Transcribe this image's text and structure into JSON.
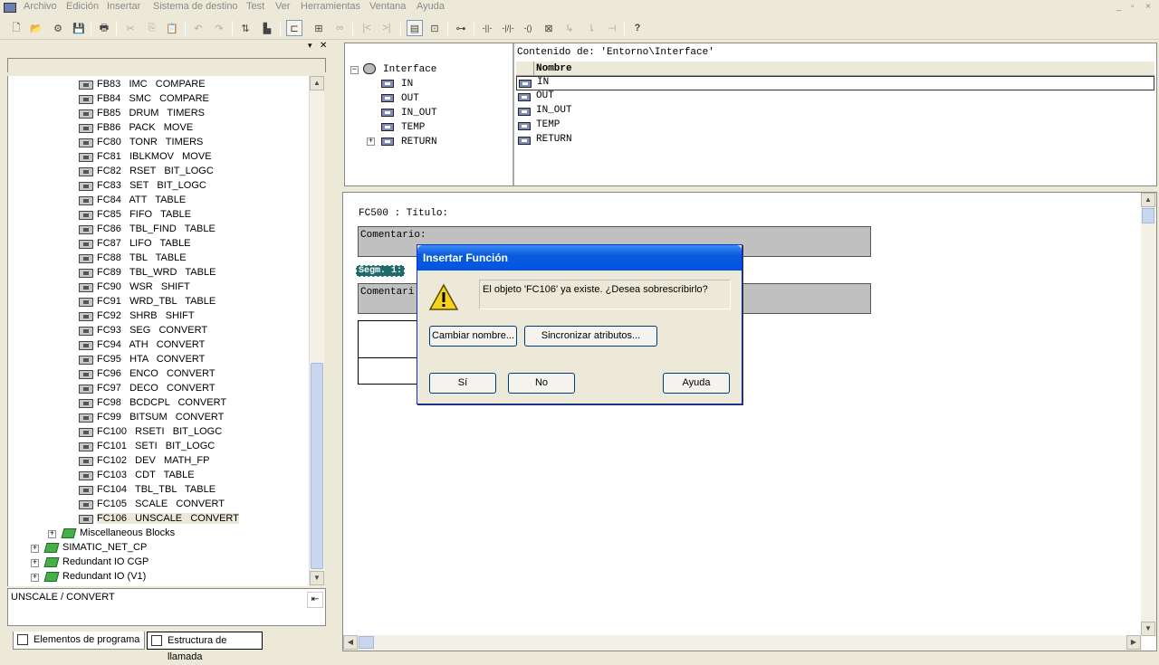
{
  "menu": {
    "items": [
      "Archivo",
      "Edición",
      "Insertar",
      "Sistema de destino",
      "Test",
      "Ver",
      "Herramientas",
      "Ventana",
      "Ayuda"
    ],
    "window_controls": [
      "_",
      "▫",
      "×"
    ]
  },
  "toolbar": {
    "buttons": [
      {
        "name": "new-icon",
        "glyph": "🗋"
      },
      {
        "name": "open-icon",
        "glyph": "📂"
      },
      {
        "name": "accessible-nodes-icon",
        "glyph": "⚙"
      },
      {
        "name": "save-icon",
        "glyph": "💾"
      },
      {
        "name": "print-icon",
        "glyph": "🖶"
      },
      {
        "name": "cut-icon",
        "glyph": "✂"
      },
      {
        "name": "copy-icon",
        "glyph": "⎘"
      },
      {
        "name": "paste-icon",
        "glyph": "📋"
      },
      {
        "name": "undo-icon",
        "glyph": "↶"
      },
      {
        "name": "redo-icon",
        "glyph": "↷"
      },
      {
        "name": "load-icon",
        "glyph": "⇅"
      },
      {
        "name": "download-icon",
        "glyph": "▙"
      },
      {
        "name": "monitor-icon",
        "glyph": "⊏"
      },
      {
        "name": "module-icon",
        "glyph": "⊞"
      },
      {
        "name": "glasses-icon",
        "glyph": "∞"
      },
      {
        "name": "prev-icon",
        "glyph": "|<"
      },
      {
        "name": "next-icon",
        "glyph": ">|"
      },
      {
        "name": "overview-icon",
        "glyph": "▤"
      },
      {
        "name": "zoom-icon",
        "glyph": "⊡"
      },
      {
        "name": "network-icon",
        "glyph": "⊶"
      },
      {
        "name": "contact-no-icon",
        "glyph": "-||-"
      },
      {
        "name": "contact-nc-icon",
        "glyph": "-|/|-"
      },
      {
        "name": "coil-icon",
        "glyph": "-()"
      },
      {
        "name": "box-icon",
        "glyph": "⊠"
      },
      {
        "name": "branch-open-icon",
        "glyph": "↳"
      },
      {
        "name": "branch-close-icon",
        "glyph": "⇂"
      },
      {
        "name": "connection-icon",
        "glyph": "⊣"
      },
      {
        "name": "help-icon",
        "glyph": "?"
      }
    ]
  },
  "left_pane": {
    "tree": [
      {
        "label": "FB83   IMC   COMPARE"
      },
      {
        "label": "FB84   SMC   COMPARE"
      },
      {
        "label": "FB85   DRUM   TIMERS"
      },
      {
        "label": "FB86   PACK   MOVE"
      },
      {
        "label": "FC80   TONR   TIMERS"
      },
      {
        "label": "FC81   IBLKMOV   MOVE"
      },
      {
        "label": "FC82   RSET   BIT_LOGC"
      },
      {
        "label": "FC83   SET   BIT_LOGC"
      },
      {
        "label": "FC84   ATT   TABLE"
      },
      {
        "label": "FC85   FIFO   TABLE"
      },
      {
        "label": "FC86   TBL_FIND   TABLE"
      },
      {
        "label": "FC87   LIFO   TABLE"
      },
      {
        "label": "FC88   TBL   TABLE"
      },
      {
        "label": "FC89   TBL_WRD   TABLE"
      },
      {
        "label": "FC90   WSR   SHIFT"
      },
      {
        "label": "FC91   WRD_TBL   TABLE"
      },
      {
        "label": "FC92   SHRB   SHIFT"
      },
      {
        "label": "FC93   SEG   CONVERT"
      },
      {
        "label": "FC94   ATH   CONVERT"
      },
      {
        "label": "FC95   HTA   CONVERT"
      },
      {
        "label": "FC96   ENCO   CONVERT"
      },
      {
        "label": "FC97   DECO   CONVERT"
      },
      {
        "label": "FC98   BCDCPL   CONVERT"
      },
      {
        "label": "FC99   BITSUM   CONVERT"
      },
      {
        "label": "FC100   RSETI   BIT_LOGC"
      },
      {
        "label": "FC101   SETI   BIT_LOGC"
      },
      {
        "label": "FC102   DEV   MATH_FP"
      },
      {
        "label": "FC103   CDT   TABLE"
      },
      {
        "label": "FC104   TBL_TBL   TABLE"
      },
      {
        "label": "FC105   SCALE   CONVERT"
      },
      {
        "label": "FC106   UNSCALE   CONVERT"
      }
    ],
    "folders": [
      {
        "label": "Miscellaneous Blocks"
      },
      {
        "label": "SIMATIC_NET_CP"
      },
      {
        "label": "Redundant IO CGP"
      },
      {
        "label": "Redundant IO (V1)"
      }
    ],
    "status_text": "UNSCALE / CONVERT",
    "tabs": [
      "Elementos de programa",
      "Estructura de llamada"
    ]
  },
  "interface": {
    "root": "Interface",
    "tree_items": [
      "IN",
      "OUT",
      "IN_OUT",
      "TEMP",
      "RETURN"
    ],
    "content_title": "Contenido de: 'Entorno\\Interface'",
    "column_header": "Nombre",
    "list_items": [
      "IN",
      "OUT",
      "IN_OUT",
      "TEMP",
      "RETURN"
    ]
  },
  "editor": {
    "block_title": "FC500 : Título:",
    "comment_label": "Comentario:",
    "network_label": "Segm. 1:",
    "network_comment_label": "Comentari"
  },
  "dialog": {
    "title": "Insertar Función",
    "message": "El objeto 'FC106' ya existe. ¿Desea sobrescribirlo?",
    "rename_button": "Cambiar nombre...",
    "sync_button": "Sincronizar atributos...",
    "yes_button": "Sí",
    "no_button": "No",
    "help_button": "Ayuda"
  }
}
